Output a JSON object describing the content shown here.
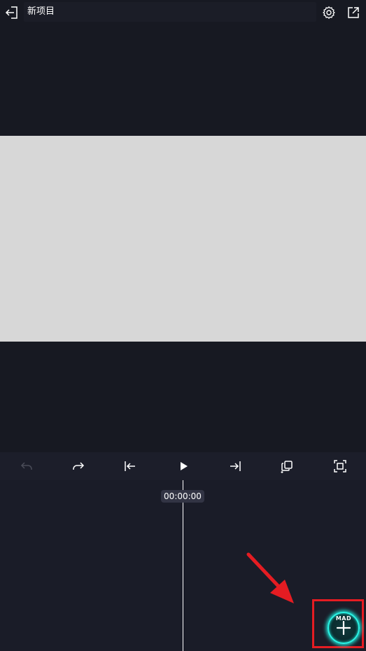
{
  "header": {
    "title": "新项目",
    "icons": {
      "exit": "exit-icon",
      "settings": "gear-icon",
      "export": "export-icon"
    }
  },
  "controls": {
    "icons": [
      "undo-icon",
      "redo-icon",
      "skip-to-start-icon",
      "play-icon",
      "skip-to-end-icon",
      "duplicate-icon",
      "fullscreen-icon"
    ],
    "undo_enabled": false
  },
  "timeline": {
    "timecode": "00:00:00"
  },
  "add_media": {
    "logo_text": "MAD",
    "icon": "plus-icon"
  },
  "colors": {
    "background": "#171922",
    "canvas": "#d7d7d7",
    "accent": "#2af3e4",
    "annotation": "#e51c22"
  }
}
